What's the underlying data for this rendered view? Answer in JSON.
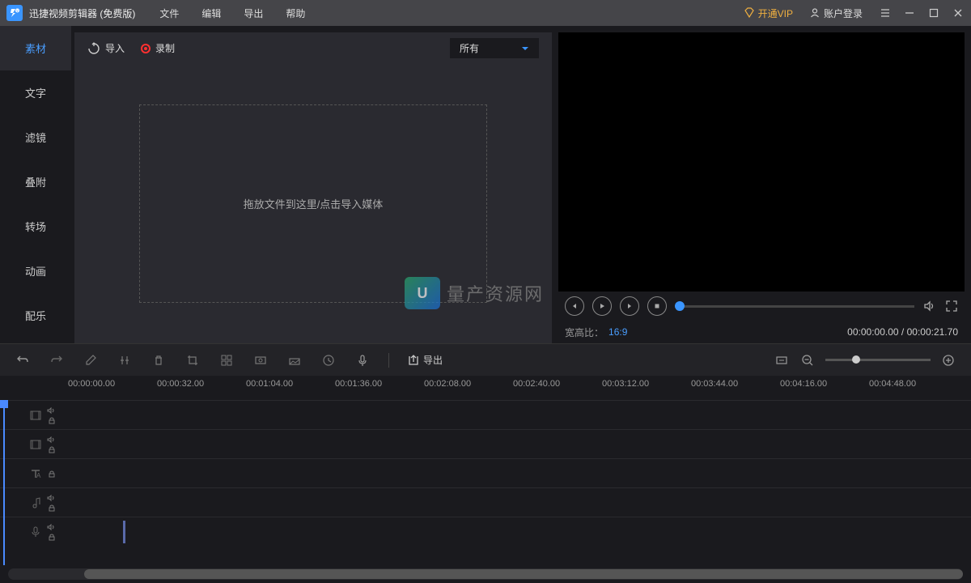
{
  "titlebar": {
    "app_name": "迅捷视频剪辑器 (免费版)",
    "menu": [
      "文件",
      "编辑",
      "导出",
      "帮助"
    ],
    "vip_label": "开通VIP",
    "login_label": "账户登录"
  },
  "sidebar": {
    "tabs": [
      "素材",
      "文字",
      "滤镜",
      "叠附",
      "转场",
      "动画",
      "配乐"
    ],
    "active_index": 0
  },
  "media": {
    "import_label": "导入",
    "record_label": "录制",
    "filter_label": "所有",
    "dropzone_text": "拖放文件到这里/点击导入媒体"
  },
  "preview": {
    "aspect_label": "宽高比：",
    "aspect_value": "16:9",
    "time_current": "00:00:00.00",
    "time_total": "00:00:21.70"
  },
  "timeline_toolbar": {
    "export_label": "导出"
  },
  "ruler": {
    "marks": [
      "00:00:00.00",
      "00:00:32.00",
      "00:01:04.00",
      "00:01:36.00",
      "00:02:08.00",
      "00:02:40.00",
      "00:03:12.00",
      "00:03:44.00",
      "00:04:16.00",
      "00:04:48.00"
    ]
  },
  "watermark": {
    "text": "量产资源网"
  }
}
